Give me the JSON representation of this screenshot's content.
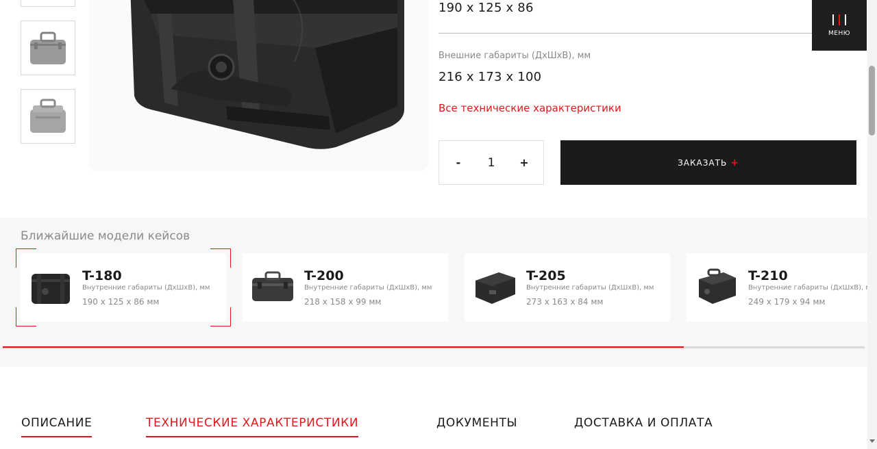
{
  "thumbnails": [
    {
      "icon": "case-thumbnail-icon"
    },
    {
      "icon": "case-thumbnail-icon"
    },
    {
      "icon": "case-thumbnail-icon"
    }
  ],
  "main_image": {
    "icon": "case-photo-icon"
  },
  "specs": {
    "inner_value": "190 x 125 x 86",
    "outer_label": "Внешние габариты (ДхШхВ), мм",
    "outer_value": "216 x 173 x 100"
  },
  "tech_link": "Все технические характеристики",
  "quantity": {
    "minus": "-",
    "value": "1",
    "plus": "+"
  },
  "order": {
    "label": "ЗАКАЗАТЬ",
    "plus": "+"
  },
  "menu": {
    "label": "МЕНЮ",
    "icon": "menu-icon"
  },
  "models": {
    "title": "Ближайшие модели кейсов",
    "items": [
      {
        "name": "T-180",
        "label": "Внутренние габариты (ДхШхВ), мм",
        "dims": "190 x 125 x 86 мм",
        "active": true
      },
      {
        "name": "T-200",
        "label": "Внутренние габариты (ДхШхВ), мм",
        "dims": "218 x 158 x 99 мм",
        "active": false
      },
      {
        "name": "T-205",
        "label": "Внутренние габариты (ДхШхВ), мм",
        "dims": "273 x 163 x 84 мм",
        "active": false
      },
      {
        "name": "T-210",
        "label": "Внутренние габариты (ДхШхВ), мм",
        "dims": "249 x 179 x 94 мм",
        "active": false
      }
    ],
    "progress": 0.79
  },
  "tabs": [
    {
      "label": "ОПИСАНИЕ",
      "state": "underlined"
    },
    {
      "label": "ТЕХНИЧЕСКИЕ ХАРАКТЕРИСТИКИ",
      "state": "active"
    },
    {
      "label": "ДОКУМЕНТЫ",
      "state": "plain"
    },
    {
      "label": "ДОСТАВКА И ОПЛАТА",
      "state": "plain"
    }
  ],
  "colors": {
    "accent": "#e3161b",
    "dark": "#1b1b1b",
    "muted": "#8a8a8a"
  }
}
